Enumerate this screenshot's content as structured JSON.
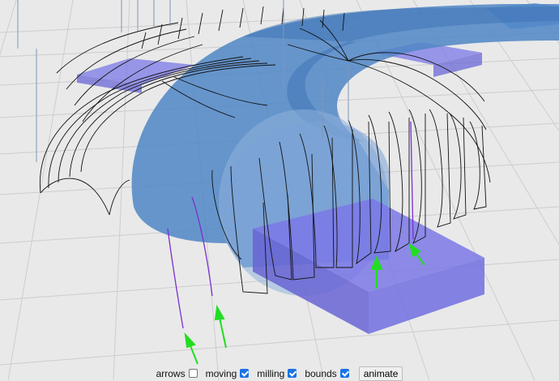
{
  "controls": {
    "arrows": {
      "label": "arrows",
      "checked": false
    },
    "moving": {
      "label": "moving",
      "checked": true
    },
    "milling": {
      "label": "milling",
      "checked": true
    },
    "bounds": {
      "label": "bounds",
      "checked": true
    },
    "animate_label": "animate"
  },
  "colors": {
    "background": "#e9e9e9",
    "grid": "#cfcfcf",
    "torus": "#4f86c6",
    "stock_box": "#7b78e6",
    "toolpath": "#111111",
    "active_path": "#7a2fd0",
    "arrow": "#22dd22"
  }
}
